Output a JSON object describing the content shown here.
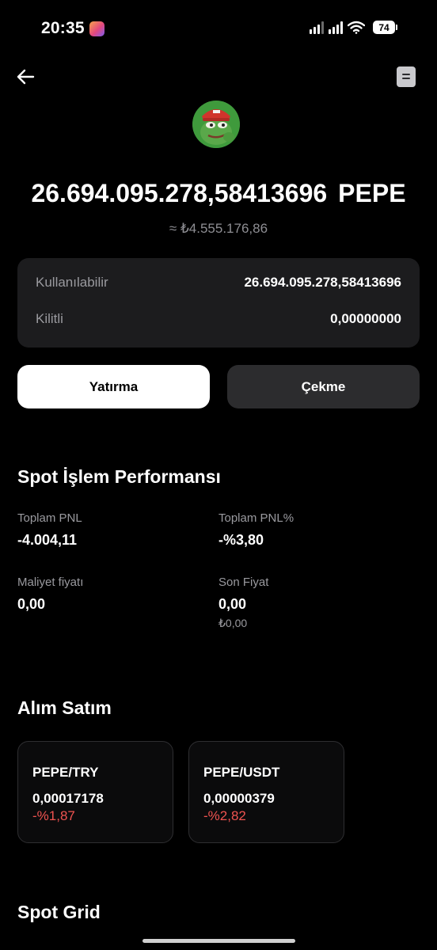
{
  "status_bar": {
    "time": "20:35",
    "battery": "74"
  },
  "coin": {
    "amount": "26.694.095.278,58413696",
    "ticker": "PEPE",
    "fiat_equiv": "≈ ₺4.555.176,86"
  },
  "balance": {
    "available_label": "Kullanılabilir",
    "available_value": "26.694.095.278,58413696",
    "locked_label": "Kilitli",
    "locked_value": "0,00000000"
  },
  "actions": {
    "deposit_label": "Yatırma",
    "withdraw_label": "Çekme"
  },
  "performance": {
    "title": "Spot İşlem Performansı",
    "total_pnl_label": "Toplam PNL",
    "total_pnl_value": "-4.004,11",
    "total_pnl_pct_label": "Toplam PNL%",
    "total_pnl_pct_value": "-%3,80",
    "cost_price_label": "Maliyet fiyatı",
    "cost_price_value": "0,00",
    "last_price_label": "Son Fiyat",
    "last_price_value": "0,00",
    "last_price_fiat": "₺0,00"
  },
  "trading": {
    "title": "Alım Satım",
    "pairs": [
      {
        "name": "PEPE/TRY",
        "price": "0,00017178",
        "change": "-%1,87"
      },
      {
        "name": "PEPE/USDT",
        "price": "0,00000379",
        "change": "-%2,82"
      }
    ]
  },
  "spot_grid": {
    "title": "Spot Grid"
  },
  "colors": {
    "background": "#000000",
    "card": "#1c1c1e",
    "negative": "#ef5350",
    "muted_text": "#9a9a9f"
  },
  "icons": {
    "back": "arrow-left-icon",
    "history": "document-icon",
    "coin": "pepe-coin-icon"
  }
}
